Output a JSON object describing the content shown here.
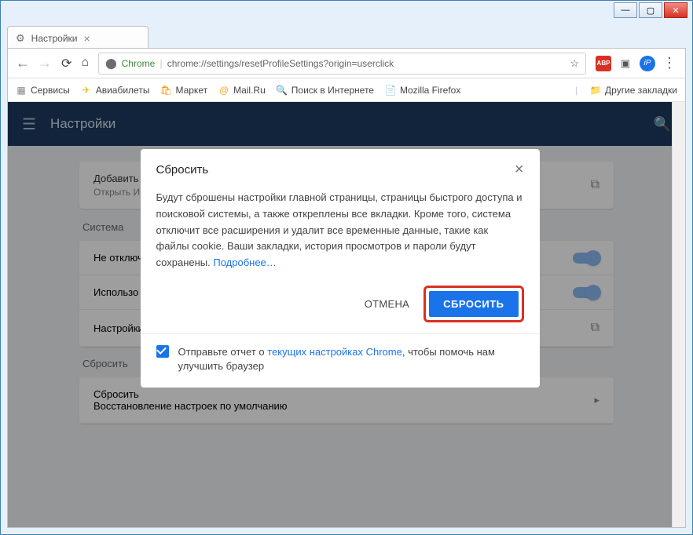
{
  "window": {
    "tab_title": "Настройки"
  },
  "omnibox": {
    "origin_label": "Chrome",
    "url": "chrome://settings/resetProfileSettings?origin=userclick"
  },
  "bookmarks": {
    "apps": "Сервисы",
    "avia": "Авиабилеты",
    "market": "Маркет",
    "mailru": "Mail.Ru",
    "search": "Поиск в Интернете",
    "firefox": "Mozilla Firefox",
    "other": "Другие закладки"
  },
  "settings": {
    "header_title": "Настройки",
    "card_access": {
      "title": "Добавить специальные возможности",
      "sub": "Открыть Интернет-магазин Chrome"
    },
    "section_system": "Система",
    "row_dont_off": "Не отключ",
    "row_use": "Использо",
    "row_settings": "Настройки",
    "section_reset": "Сбросить",
    "row_reset_title": "Сбросить",
    "row_reset_sub": "Восстановление настроек по умолчанию"
  },
  "dialog": {
    "title": "Сбросить",
    "body": "Будут сброшены настройки главной страницы, страницы быстрого доступа и поисковой системы, а также откреплены все вкладки. Кроме того, система отключит все расширения и удалит все временные данные, такие как файлы cookie. Ваши закладки, история просмотров и пароли будут сохранены.",
    "learn_more": "Подробнее…",
    "cancel": "ОТМЕНА",
    "confirm": "СБРОСИТЬ",
    "report_prefix": "Отправьте отчет о ",
    "report_link": "текущих настройках Chrome",
    "report_suffix": ", чтобы помочь нам улучшить браузер"
  }
}
